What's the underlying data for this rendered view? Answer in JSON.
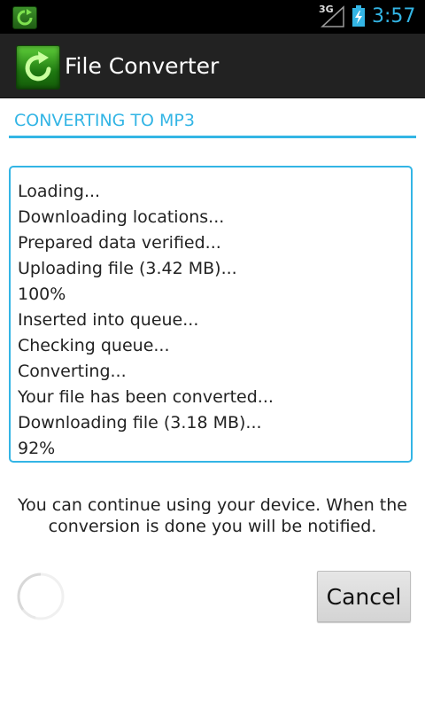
{
  "status_bar": {
    "network": "3G",
    "time": "3:57",
    "notification_icon": "file-converter-icon",
    "accent_color": "#33b5e5"
  },
  "action_bar": {
    "title": "File Converter",
    "logo_icon": "refresh-arrow-icon"
  },
  "section": {
    "header": "CONVERTING TO MP3"
  },
  "log": {
    "lines": [
      "Loading...",
      "Downloading locations...",
      "Prepared data verified...",
      "Uploading file (3.42 MB)...",
      "100%",
      "Inserted into queue...",
      "Checking queue...",
      "Converting...",
      "Your file has been converted...",
      "Downloading file (3.18 MB)...",
      "92%"
    ]
  },
  "notice": {
    "text": "You can continue using your device. When the conversion is done you will be notified."
  },
  "actions": {
    "cancel_label": "Cancel"
  },
  "progress": {
    "spinner_icon": "loading-spinner-icon"
  }
}
